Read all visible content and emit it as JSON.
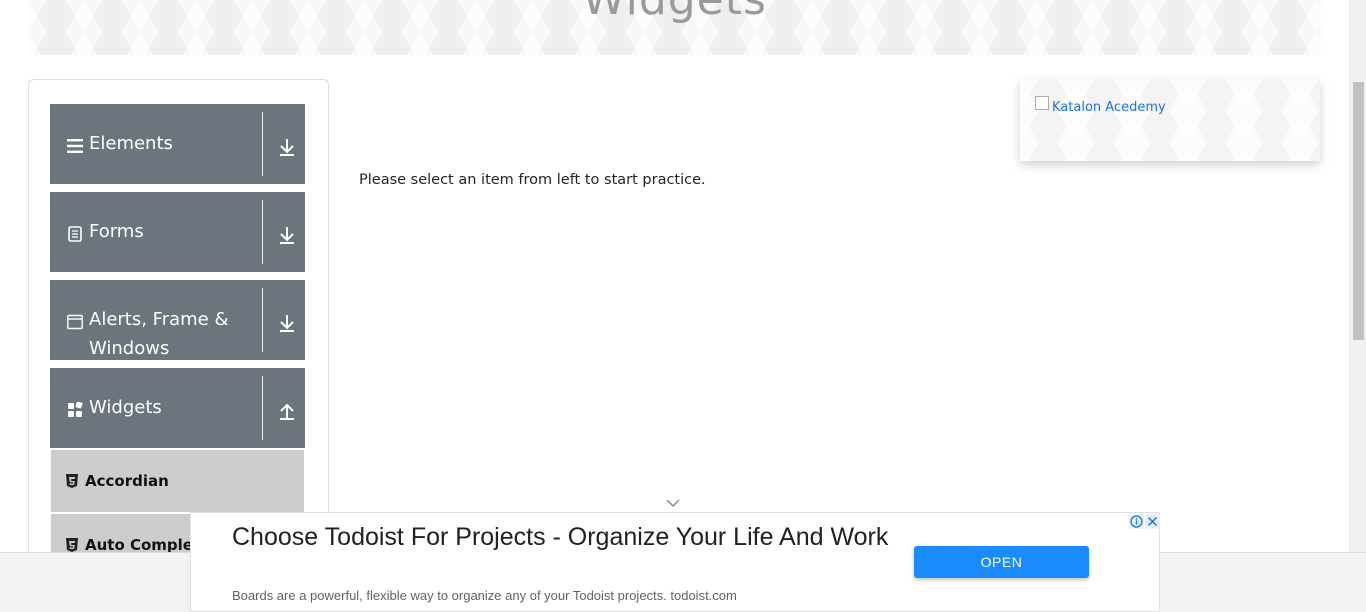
{
  "banner": {
    "title": "Widgets"
  },
  "sidebar": {
    "groups": [
      {
        "label": "Elements",
        "icon": "hamburger-icon",
        "arrow": "download-arrow-icon"
      },
      {
        "label": "Forms",
        "icon": "document-icon",
        "arrow": "download-arrow-icon"
      },
      {
        "label": "Alerts, Frame & Windows",
        "icon": "window-icon",
        "arrow": "download-arrow-icon"
      },
      {
        "label": "Widgets",
        "icon": "grid-icon",
        "arrow": "upload-arrow-icon"
      }
    ],
    "items": [
      {
        "label": "Accordian",
        "icon": "html5-icon"
      },
      {
        "label": "Auto Complete",
        "icon": "html5-icon"
      }
    ]
  },
  "main": {
    "prompt": "Please select an item from left to start practice."
  },
  "katalon": {
    "alt_text": "Katalon Acedemy"
  },
  "ad": {
    "title": "Choose Todoist For Projects - Organize Your Life And Work",
    "description": "Boards are a powerful, flexible way to organize any of your Todoist projects. todoist.com",
    "button": "OPEN",
    "button_color": "#1a8cff"
  },
  "colors": {
    "group_bg": "#6c757d",
    "item_bg": "#cccccc"
  }
}
